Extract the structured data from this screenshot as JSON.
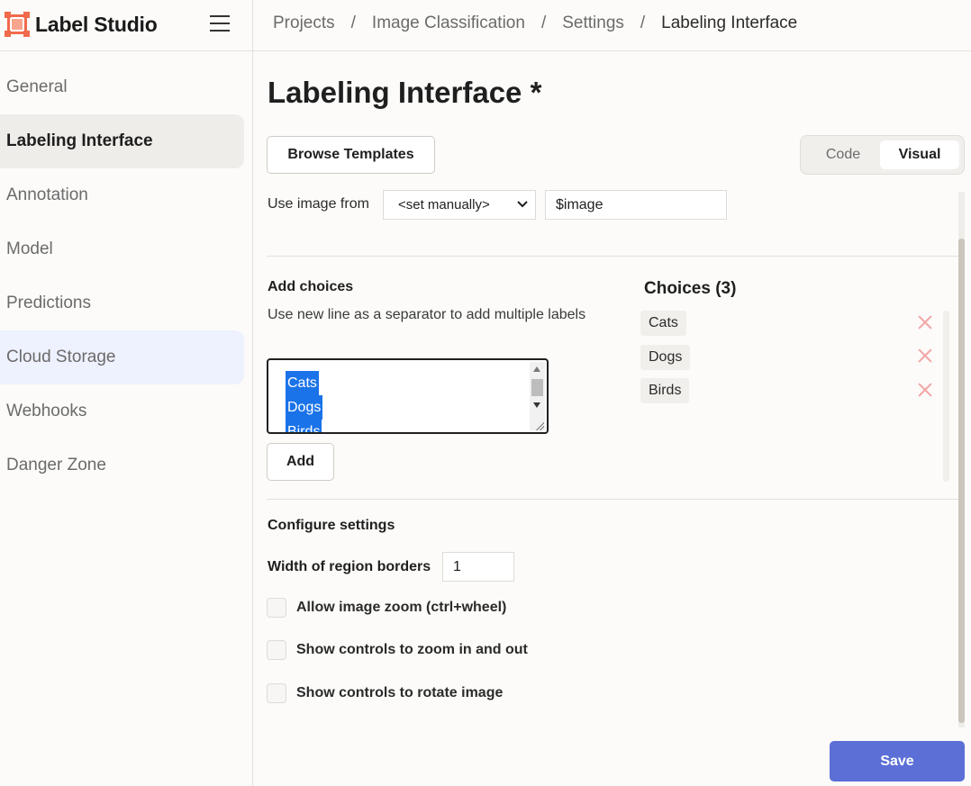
{
  "app": {
    "name": "Label Studio"
  },
  "breadcrumb": {
    "items": [
      "Projects",
      "Image Classification",
      "Settings"
    ],
    "separator": "/",
    "current": "Labeling Interface"
  },
  "sidebar": {
    "items": [
      {
        "label": "General",
        "state": "normal"
      },
      {
        "label": "Labeling Interface",
        "state": "active"
      },
      {
        "label": "Annotation",
        "state": "normal"
      },
      {
        "label": "Model",
        "state": "normal"
      },
      {
        "label": "Predictions",
        "state": "normal"
      },
      {
        "label": "Cloud Storage",
        "state": "hover"
      },
      {
        "label": "Webhooks",
        "state": "normal"
      },
      {
        "label": "Danger Zone",
        "state": "normal"
      }
    ]
  },
  "main": {
    "title": "Labeling Interface *",
    "browse_templates": "Browse Templates",
    "mode_toggle": {
      "code": "Code",
      "visual": "Visual",
      "selected": "Visual"
    },
    "image_source": {
      "label": "Use image from",
      "select_value": "<set manually>",
      "input_value": "$image"
    },
    "add_choices": {
      "title": "Add choices",
      "hint": "Use new line as a separator to add multiple labels",
      "textarea_lines": [
        "Cats",
        "Dogs",
        "Birds"
      ],
      "add_button": "Add"
    },
    "choices": {
      "title": "Choices (3)",
      "items": [
        "Cats",
        "Dogs",
        "Birds"
      ]
    },
    "configure": {
      "title": "Configure settings",
      "border_width_label": "Width of region borders",
      "border_width_value": "1",
      "options": [
        {
          "label": "Allow image zoom (ctrl+wheel)",
          "checked": false
        },
        {
          "label": "Show controls to zoom in and out",
          "checked": false
        },
        {
          "label": "Show controls to rotate image",
          "checked": false
        }
      ]
    },
    "save_button": "Save"
  },
  "colors": {
    "brand": "#f06a4b",
    "primary": "#5b6fd6",
    "selection": "#1a73e8",
    "delete": "#f3a6a6",
    "sidebar_active": "#efedea",
    "sidebar_hover": "#eef1fe"
  },
  "icons": {
    "menu": "hamburger-icon",
    "remove_choice": "close-icon",
    "select_arrow": "chevron-down-icon",
    "logo": "label-studio-logo-icon"
  }
}
